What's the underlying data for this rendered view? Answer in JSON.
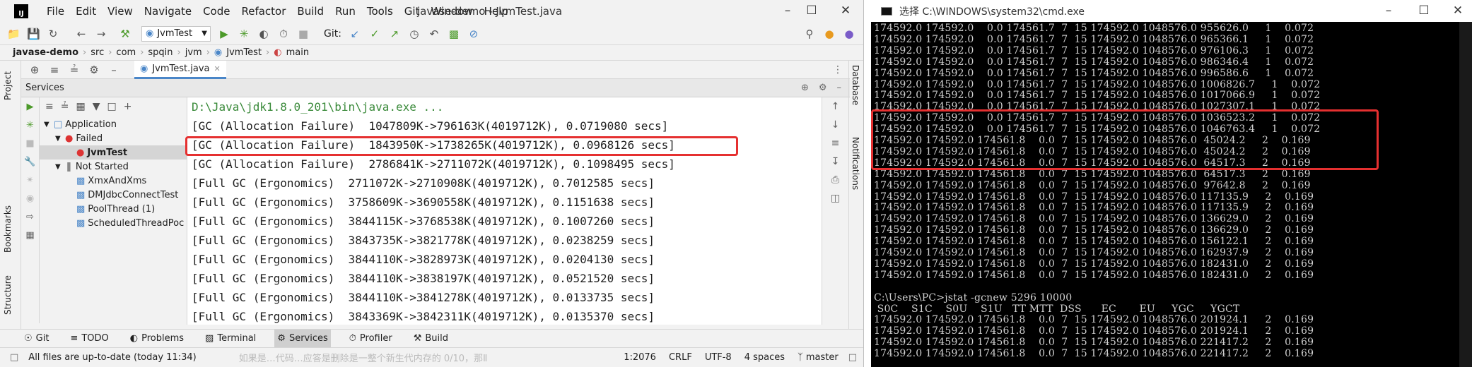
{
  "ide": {
    "logo": "IJ",
    "menu": [
      "File",
      "Edit",
      "View",
      "Navigate",
      "Code",
      "Refactor",
      "Build",
      "Run",
      "Tools",
      "Git",
      "Window",
      "Help"
    ],
    "window_title": "javase-demo - JvmTest.java",
    "run_config": "JvmTest",
    "git_label": "Git:",
    "breadcrumb": [
      "javase-demo",
      "src",
      "com",
      "spqin",
      "jvm",
      "JvmTest",
      "main"
    ],
    "left_strip": [
      "Project",
      "Bookmarks",
      "Structure"
    ],
    "right_strip": [
      "Database",
      "Notifications"
    ],
    "file_tab": "JvmTest.java",
    "services_title": "Services",
    "tree": [
      {
        "label": "Application",
        "indent": 0
      },
      {
        "label": "Failed",
        "indent": 1
      },
      {
        "label": "JvmTest",
        "indent": 2
      },
      {
        "label": "Not Started",
        "indent": 1
      },
      {
        "label": "XmxAndXms",
        "indent": 2
      },
      {
        "label": "DMJdbcConnectTest",
        "indent": 2
      },
      {
        "label": "PoolThread (1)",
        "indent": 2
      },
      {
        "label": "ScheduledThreadPoc",
        "indent": 2
      }
    ],
    "console_lines": [
      "D:\\Java\\jdk1.8.0_201\\bin\\java.exe ...",
      "[GC (Allocation Failure)  1047809K->796163K(4019712K), 0.0719080 secs]",
      "[GC (Allocation Failure)  1843950K->1738265K(4019712K), 0.0968126 secs]",
      "[GC (Allocation Failure)  2786841K->2711072K(4019712K), 0.1098495 secs]",
      "[Full GC (Ergonomics)  2711072K->2710908K(4019712K), 0.7012585 secs]",
      "[Full GC (Ergonomics)  3758609K->3690558K(4019712K), 0.1151638 secs]",
      "[Full GC (Ergonomics)  3844115K->3768538K(4019712K), 0.1007260 secs]",
      "[Full GC (Ergonomics)  3843735K->3821778K(4019712K), 0.0238259 secs]",
      "[Full GC (Ergonomics)  3844110K->3828973K(4019712K), 0.0204130 secs]",
      "[Full GC (Ergonomics)  3844110K->3838197K(4019712K), 0.0521520 secs]",
      "[Full GC (Ergonomics)  3844110K->3841278K(4019712K), 0.0133735 secs]",
      "[Full GC (Ergonomics)  3843369K->3842311K(4019712K), 0.0135370 secs]"
    ],
    "bottom_tabs": [
      "Git",
      "TODO",
      "Problems",
      "Terminal",
      "Services",
      "Profiler",
      "Build"
    ],
    "status_left": "All files are up-to-date (today 11:34)",
    "status_right": [
      "1:2076",
      "CRLF",
      "UTF-8",
      "4 spaces",
      "master"
    ],
    "behind_text": "如果是…代码…应答是删除是一整个新生代内存的 0/10，那Ⅱ"
  },
  "cmd": {
    "title": "选择 C:\\WINDOWS\\system32\\cmd.exe",
    "lines": [
      "174592.0 174592.0    0.0 174561.7  7  15 174592.0 1048576.0 955626.0     1    0.072",
      "174592.0 174592.0    0.0 174561.7  7  15 174592.0 1048576.0 965366.1     1    0.072",
      "174592.0 174592.0    0.0 174561.7  7  15 174592.0 1048576.0 976106.3     1    0.072",
      "174592.0 174592.0    0.0 174561.7  7  15 174592.0 1048576.0 986346.4     1    0.072",
      "174592.0 174592.0    0.0 174561.7  7  15 174592.0 1048576.0 996586.6     1    0.072",
      "174592.0 174592.0    0.0 174561.7  7  15 174592.0 1048576.0 1006826.7     1    0.072",
      "174592.0 174592.0    0.0 174561.7  7  15 174592.0 1048576.0 1017066.9     1    0.072",
      "174592.0 174592.0    0.0 174561.7  7  15 174592.0 1048576.0 1027307.1     1    0.072",
      "174592.0 174592.0    0.0 174561.7  7  15 174592.0 1048576.0 1036523.2     1    0.072",
      "174592.0 174592.0    0.0 174561.7  7  15 174592.0 1048576.0 1046763.4     1    0.072",
      "174592.0 174592.0 174561.8    0.0  7  15 174592.0 1048576.0  45024.2     2    0.169",
      "174592.0 174592.0 174561.8    0.0  7  15 174592.0 1048576.0  45024.2     2    0.169",
      "174592.0 174592.0 174561.8    0.0  7  15 174592.0 1048576.0  64517.3     2    0.169",
      "174592.0 174592.0 174561.8    0.0  7  15 174592.0 1048576.0  64517.3     2    0.169",
      "174592.0 174592.0 174561.8    0.0  7  15 174592.0 1048576.0  97642.8     2    0.169",
      "174592.0 174592.0 174561.8    0.0  7  15 174592.0 1048576.0 117135.9     2    0.169",
      "174592.0 174592.0 174561.8    0.0  7  15 174592.0 1048576.0 117135.9     2    0.169",
      "174592.0 174592.0 174561.8    0.0  7  15 174592.0 1048576.0 136629.0     2    0.169",
      "174592.0 174592.0 174561.8    0.0  7  15 174592.0 1048576.0 136629.0     2    0.169",
      "174592.0 174592.0 174561.8    0.0  7  15 174592.0 1048576.0 156122.1     2    0.169",
      "174592.0 174592.0 174561.8    0.0  7  15 174592.0 1048576.0 162937.9     2    0.169",
      "174592.0 174592.0 174561.8    0.0  7  15 174592.0 1048576.0 182431.0     2    0.169",
      "174592.0 174592.0 174561.8    0.0  7  15 174592.0 1048576.0 182431.0     2    0.169",
      "",
      "C:\\Users\\PC>jstat -gcnew 5296 10000",
      " S0C    S1C    S0U    S1U   TT MTT  DSS      EC       EU     YGC     YGCT",
      "174592.0 174592.0 174561.8    0.0  7  15 174592.0 1048576.0 201924.1     2    0.169",
      "174592.0 174592.0 174561.8    0.0  7  15 174592.0 1048576.0 201924.1     2    0.169",
      "174592.0 174592.0 174561.8    0.0  7  15 174592.0 1048576.0 221417.2     2    0.169",
      "174592.0 174592.0 174561.8    0.0  7  15 174592.0 1048576.0 221417.2     2    0.169"
    ]
  }
}
